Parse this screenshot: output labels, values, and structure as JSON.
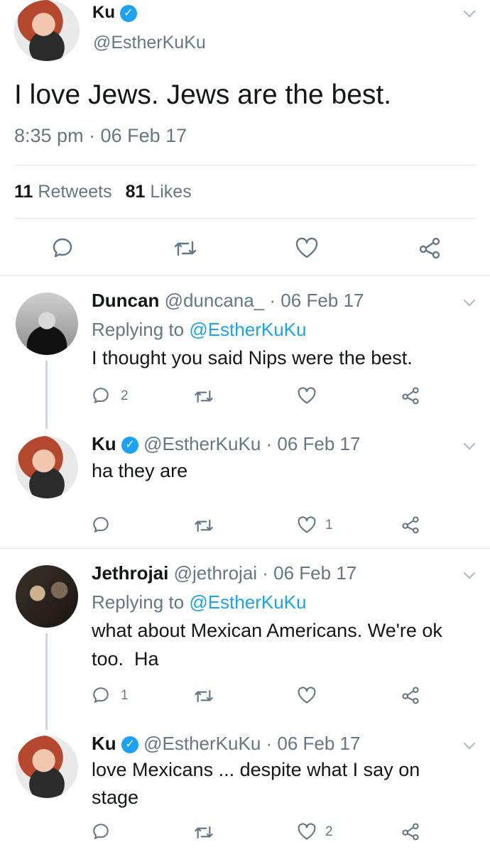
{
  "main_tweet": {
    "name": "Ku",
    "handle": "@EstherKuKu",
    "text": "I love Jews. Jews are the best.",
    "timestamp": "8:35 pm · 06 Feb 17",
    "retweets_count": "11",
    "retweets_label": "Retweets",
    "likes_count": "81",
    "likes_label": "Likes"
  },
  "replies": [
    {
      "name": "Duncan",
      "meta": "@duncana_ · 06 Feb 17",
      "replying_prefix": "Replying to",
      "replying_to": "@EstherKuKu",
      "text": "I thought you said Nips were the best.",
      "reply_count": "2",
      "retweet_count": "",
      "like_count": ""
    },
    {
      "name": "Ku",
      "meta": "@EstherKuKu · 06 Feb 17",
      "text": "ha they are",
      "reply_count": "",
      "retweet_count": "",
      "like_count": "1"
    },
    {
      "name": "Jethrojai",
      "meta": "@jethrojai · 06 Feb 17",
      "replying_prefix": "Replying to",
      "replying_to": "@EstherKuKu",
      "text_line1": "what about Mexican Americans. We're ok",
      "text_line2": "too.  Ha",
      "reply_count": "1",
      "retweet_count": "",
      "like_count": ""
    },
    {
      "name": "Ku",
      "meta": "@EstherKuKu · 06 Feb 17",
      "text_line1": "love Mexicans ... despite what I say on",
      "text_line2": "stage",
      "reply_count": "",
      "retweet_count": "",
      "like_count": "2"
    }
  ],
  "icons": [
    "reply-icon",
    "retweet-icon",
    "like-icon",
    "share-icon",
    "verified-icon",
    "chevron-down-icon"
  ],
  "colors": {
    "accent": "#1da1f2",
    "muted": "#657786",
    "divider": "#e1e8ed"
  }
}
